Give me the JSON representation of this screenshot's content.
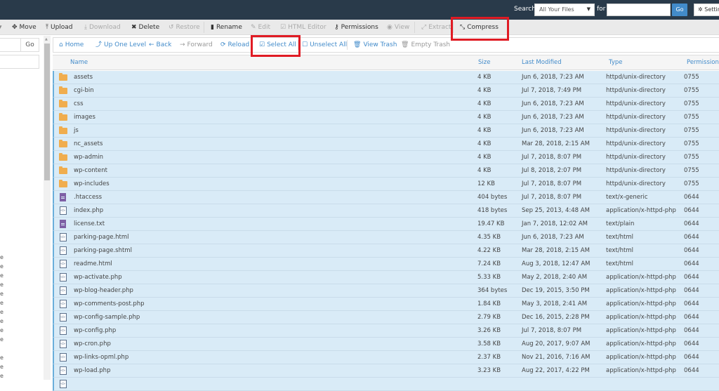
{
  "topbar": {
    "search_label": "Search",
    "search_scope": "All Your Files",
    "for_label": "for",
    "search_value": "",
    "go_label": "Go",
    "settings_label": "Settings"
  },
  "toolbar": {
    "items": [
      {
        "label": "Move",
        "icon": "move-icon",
        "disabled": false
      },
      {
        "label": "Upload",
        "icon": "upload-icon",
        "disabled": false
      },
      {
        "label": "Download",
        "icon": "download-icon",
        "disabled": true
      },
      {
        "label": "Delete",
        "icon": "delete-icon",
        "disabled": false
      },
      {
        "label": "Restore",
        "icon": "restore-icon",
        "disabled": true
      },
      {
        "label": "Rename",
        "icon": "rename-icon",
        "disabled": false
      },
      {
        "label": "Edit",
        "icon": "edit-icon",
        "disabled": true
      },
      {
        "label": "HTML Editor",
        "icon": "html-editor-icon",
        "disabled": true
      },
      {
        "label": "Permissions",
        "icon": "key-icon",
        "disabled": false
      },
      {
        "label": "View",
        "icon": "eye-icon",
        "disabled": true
      },
      {
        "label": "Extract",
        "icon": "extract-icon",
        "disabled": true
      },
      {
        "label": "Compress",
        "icon": "compress-icon",
        "disabled": false
      }
    ]
  },
  "left_panel": {
    "go_label": "Go",
    "tree_fragments": [
      "e",
      "e",
      "e",
      "e",
      "e",
      "e",
      "e",
      "e",
      "e",
      "e",
      "",
      "e",
      "e",
      "e"
    ]
  },
  "navbar": {
    "items": [
      {
        "label": "Home",
        "icon": "home-icon",
        "disabled": false
      },
      {
        "label": "Up One Level",
        "icon": "up-level-icon",
        "disabled": false
      },
      {
        "label": "Back",
        "icon": "back-arrow-icon",
        "disabled": false
      },
      {
        "label": "Forward",
        "icon": "forward-arrow-icon",
        "disabled": true
      },
      {
        "label": "Reload",
        "icon": "reload-icon",
        "disabled": false
      },
      {
        "label": "Select All",
        "icon": "checkbox-checked-icon",
        "disabled": false
      },
      {
        "label": "Unselect All",
        "icon": "checkbox-empty-icon",
        "disabled": false
      },
      {
        "label": "View Trash",
        "icon": "trash-icon",
        "disabled": false
      },
      {
        "label": "Empty Trash",
        "icon": "trash-icon",
        "disabled": true
      }
    ]
  },
  "table": {
    "headers": {
      "name": "Name",
      "size": "Size",
      "modified": "Last Modified",
      "type": "Type",
      "permissions": "Permissions"
    },
    "rows": [
      {
        "kind": "folder",
        "name": "assets",
        "size": "4 KB",
        "modified": "Jun 6, 2018, 7:23 AM",
        "type": "httpd/unix-directory",
        "perm": "0755"
      },
      {
        "kind": "folder",
        "name": "cgi-bin",
        "size": "4 KB",
        "modified": "Jul 7, 2018, 7:49 PM",
        "type": "httpd/unix-directory",
        "perm": "0755"
      },
      {
        "kind": "folder",
        "name": "css",
        "size": "4 KB",
        "modified": "Jun 6, 2018, 7:23 AM",
        "type": "httpd/unix-directory",
        "perm": "0755"
      },
      {
        "kind": "folder",
        "name": "images",
        "size": "4 KB",
        "modified": "Jun 6, 2018, 7:23 AM",
        "type": "httpd/unix-directory",
        "perm": "0755"
      },
      {
        "kind": "folder",
        "name": "js",
        "size": "4 KB",
        "modified": "Jun 6, 2018, 7:23 AM",
        "type": "httpd/unix-directory",
        "perm": "0755"
      },
      {
        "kind": "folder",
        "name": "nc_assets",
        "size": "4 KB",
        "modified": "Mar 28, 2018, 2:15 AM",
        "type": "httpd/unix-directory",
        "perm": "0755"
      },
      {
        "kind": "folder",
        "name": "wp-admin",
        "size": "4 KB",
        "modified": "Jul 7, 2018, 8:07 PM",
        "type": "httpd/unix-directory",
        "perm": "0755"
      },
      {
        "kind": "folder",
        "name": "wp-content",
        "size": "4 KB",
        "modified": "Jul 8, 2018, 2:07 PM",
        "type": "httpd/unix-directory",
        "perm": "0755"
      },
      {
        "kind": "folder",
        "name": "wp-includes",
        "size": "12 KB",
        "modified": "Jul 7, 2018, 8:07 PM",
        "type": "httpd/unix-directory",
        "perm": "0755"
      },
      {
        "kind": "text",
        "name": ".htaccess",
        "size": "404 bytes",
        "modified": "Jul 7, 2018, 8:07 PM",
        "type": "text/x-generic",
        "perm": "0644"
      },
      {
        "kind": "code",
        "name": "index.php",
        "size": "418 bytes",
        "modified": "Sep 25, 2013, 4:48 AM",
        "type": "application/x-httpd-php",
        "perm": "0644"
      },
      {
        "kind": "text",
        "name": "license.txt",
        "size": "19.47 KB",
        "modified": "Jan 7, 2018, 12:02 AM",
        "type": "text/plain",
        "perm": "0644"
      },
      {
        "kind": "code",
        "name": "parking-page.html",
        "size": "4.35 KB",
        "modified": "Jun 6, 2018, 7:23 AM",
        "type": "text/html",
        "perm": "0644"
      },
      {
        "kind": "code",
        "name": "parking-page.shtml",
        "size": "4.22 KB",
        "modified": "Mar 28, 2018, 2:15 AM",
        "type": "text/html",
        "perm": "0644"
      },
      {
        "kind": "code",
        "name": "readme.html",
        "size": "7.24 KB",
        "modified": "Aug 3, 2018, 12:47 AM",
        "type": "text/html",
        "perm": "0644"
      },
      {
        "kind": "code",
        "name": "wp-activate.php",
        "size": "5.33 KB",
        "modified": "May 2, 2018, 2:40 AM",
        "type": "application/x-httpd-php",
        "perm": "0644"
      },
      {
        "kind": "code",
        "name": "wp-blog-header.php",
        "size": "364 bytes",
        "modified": "Dec 19, 2015, 3:50 PM",
        "type": "application/x-httpd-php",
        "perm": "0644"
      },
      {
        "kind": "code",
        "name": "wp-comments-post.php",
        "size": "1.84 KB",
        "modified": "May 3, 2018, 2:41 AM",
        "type": "application/x-httpd-php",
        "perm": "0644"
      },
      {
        "kind": "code",
        "name": "wp-config-sample.php",
        "size": "2.79 KB",
        "modified": "Dec 16, 2015, 2:28 PM",
        "type": "application/x-httpd-php",
        "perm": "0644"
      },
      {
        "kind": "code",
        "name": "wp-config.php",
        "size": "3.26 KB",
        "modified": "Jul 7, 2018, 8:07 PM",
        "type": "application/x-httpd-php",
        "perm": "0644"
      },
      {
        "kind": "code",
        "name": "wp-cron.php",
        "size": "3.58 KB",
        "modified": "Aug 20, 2017, 9:07 AM",
        "type": "application/x-httpd-php",
        "perm": "0644"
      },
      {
        "kind": "code",
        "name": "wp-links-opml.php",
        "size": "2.37 KB",
        "modified": "Nov 21, 2016, 7:16 AM",
        "type": "application/x-httpd-php",
        "perm": "0644"
      },
      {
        "kind": "code",
        "name": "wp-load.php",
        "size": "3.23 KB",
        "modified": "Aug 22, 2017, 4:22 PM",
        "type": "application/x-httpd-php",
        "perm": "0644"
      },
      {
        "kind": "code",
        "name": "",
        "size": "",
        "modified": "",
        "type": "",
        "perm": ""
      }
    ]
  },
  "colors": {
    "topbar": "#293a4a",
    "accent": "#428bca",
    "selected_row": "#d9ebf7",
    "annotation": "#e01b24",
    "folder": "#f0ad4e"
  }
}
